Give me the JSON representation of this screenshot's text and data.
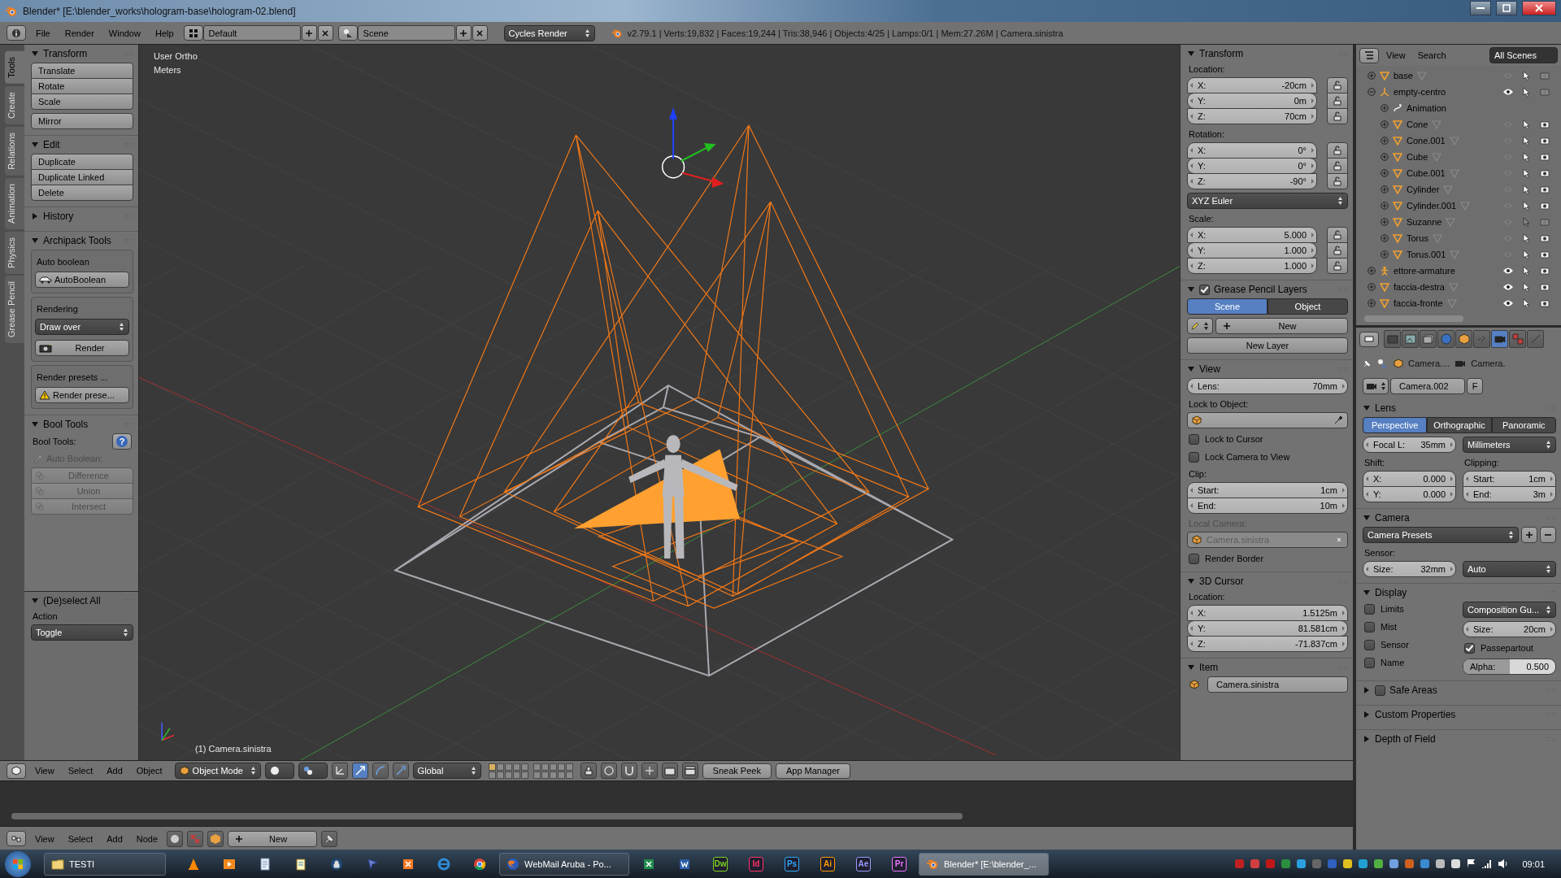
{
  "window": {
    "title": "Blender* [E:\\blender_works\\hologram-base\\hologram-02.blend]"
  },
  "info_header": {
    "menus": [
      "File",
      "Render",
      "Window",
      "Help"
    ],
    "layout": "Default",
    "scene": "Scene",
    "engine": "Cycles Render",
    "stats": "v2.79.1 | Verts:19,832 | Faces:19,244 | Tris:38,946 | Objects:4/25 | Lamps:0/1 | Mem:27.26M | Camera.sinistra"
  },
  "tool_tabs": [
    {
      "label": "Tools",
      "selected": true
    },
    {
      "label": "Create",
      "selected": false
    },
    {
      "label": "Relations",
      "selected": false
    },
    {
      "label": "Animation",
      "selected": false
    },
    {
      "label": "Physics",
      "selected": false
    },
    {
      "label": "Grease Pencil",
      "selected": false
    }
  ],
  "tool_shelf": {
    "panels": [
      {
        "title": "Transform",
        "expanded": true,
        "rows": [
          {
            "kind": "buttons",
            "labels": [
              "Translate",
              "Rotate",
              "Scale"
            ]
          },
          {
            "kind": "buttons",
            "labels": [
              "Mirror"
            ]
          }
        ]
      },
      {
        "title": "Edit",
        "expanded": true,
        "rows": [
          {
            "kind": "buttons",
            "labels": [
              "Duplicate",
              "Duplicate Linked",
              "Delete"
            ]
          }
        ]
      },
      {
        "title": "History",
        "expanded": false
      },
      {
        "title": "Archipack Tools",
        "expanded": true,
        "rows": [
          {
            "kind": "box",
            "rows": [
              {
                "kind": "label",
                "text": "Auto boolean"
              },
              {
                "kind": "car_button",
                "text": "AutoBoolean"
              }
            ]
          },
          {
            "kind": "box",
            "rows": [
              {
                "kind": "label",
                "text": "Rendering"
              },
              {
                "kind": "dropdown",
                "text": "Draw over"
              },
              {
                "kind": "render_button",
                "text": "Render"
              }
            ]
          },
          {
            "kind": "box",
            "rows": [
              {
                "kind": "label",
                "text": "Render presets ..."
              },
              {
                "kind": "warning_button",
                "text": "Render prese..."
              }
            ]
          }
        ]
      },
      {
        "title": "Bool Tools",
        "expanded": true,
        "rows": [
          {
            "kind": "help_row",
            "text": "Bool Tools:",
            "glyph": "?"
          },
          {
            "kind": "wrench_label",
            "text": "Auto Boolean:"
          },
          {
            "kind": "dim_buttons",
            "labels": [
              "Difference",
              "Union",
              "Intersect"
            ]
          }
        ]
      }
    ]
  },
  "operator_panel": {
    "panels": [
      {
        "title": "(De)select All",
        "expanded": true,
        "rows": [
          {
            "kind": "label",
            "text": "Action"
          },
          {
            "kind": "dropdown",
            "text": "Toggle"
          }
        ]
      }
    ]
  },
  "viewport": {
    "view_name": "User Ortho",
    "units": "Meters",
    "active_object": "(1) Camera.sinistra"
  },
  "n_panel": {
    "panels": [
      {
        "title": "Transform",
        "expanded": true,
        "rows": [
          {
            "kind": "label",
            "text": "Location:"
          },
          {
            "kind": "locked_numfields",
            "fields": [
              {
                "label": "X:",
                "value": "-20cm"
              },
              {
                "label": "Y:",
                "value": "0m"
              },
              {
                "label": "Z:",
                "value": "70cm"
              }
            ]
          },
          {
            "kind": "label",
            "text": "Rotation:"
          },
          {
            "kind": "locked_numfields",
            "fields": [
              {
                "label": "X:",
                "value": "0°"
              },
              {
                "label": "Y:",
                "value": "0°"
              },
              {
                "label": "Z:",
                "value": "-90°"
              }
            ]
          },
          {
            "kind": "dropdown",
            "text": "XYZ Euler"
          },
          {
            "kind": "label",
            "text": "Scale:"
          },
          {
            "kind": "locked_numfields",
            "fields": [
              {
                "label": "X:",
                "value": "5.000"
              },
              {
                "label": "Y:",
                "value": "1.000"
              },
              {
                "label": "Z:",
                "value": "1.000"
              }
            ]
          }
        ]
      },
      {
        "title": "Grease Pencil Layers",
        "checked": true,
        "expanded": true,
        "rows": [
          {
            "kind": "segmented",
            "options": [
              {
                "label": "Scene",
                "selected": true
              },
              {
                "label": "Object",
                "selected": false
              }
            ]
          },
          {
            "kind": "pencil_new",
            "text": "New"
          },
          {
            "kind": "button",
            "text": "New Layer"
          }
        ]
      },
      {
        "title": "View",
        "expanded": true,
        "rows": [
          {
            "kind": "numfields",
            "fields": [
              {
                "label": "Lens:",
                "value": "70mm"
              }
            ]
          },
          {
            "kind": "label",
            "text": "Lock to Object:"
          },
          {
            "kind": "picker_field"
          },
          {
            "kind": "checkbox",
            "text": "Lock to Cursor",
            "checked": false
          },
          {
            "kind": "checkbox",
            "text": "Lock Camera to View",
            "checked": false
          },
          {
            "kind": "label",
            "text": "Clip:"
          },
          {
            "kind": "numfields",
            "fields": [
              {
                "label": "Start:",
                "value": "1cm"
              },
              {
                "label": "End:",
                "value": "10m"
              }
            ]
          },
          {
            "kind": "dim_label",
            "text": "Local Camera:"
          },
          {
            "kind": "dim_object_field",
            "text": "Camera.sinistra"
          },
          {
            "kind": "checkbox",
            "text": "Render Border",
            "checked": false
          }
        ]
      },
      {
        "title": "3D Cursor",
        "expanded": true,
        "rows": [
          {
            "kind": "label",
            "text": "Location:"
          },
          {
            "kind": "numfields",
            "fields": [
              {
                "label": "X:",
                "value": "1.5125m"
              },
              {
                "label": "Y:",
                "value": "81.581cm"
              },
              {
                "label": "Z:",
                "value": "-71.837cm"
              }
            ]
          }
        ]
      },
      {
        "title": "Item",
        "expanded": true,
        "rows": [
          {
            "kind": "item_field",
            "text": "Camera.sinistra"
          }
        ]
      }
    ]
  },
  "outliner": {
    "menus": [
      "View",
      "Search"
    ],
    "filter": "All Scenes",
    "items": [
      {
        "name": "base",
        "kind": "mesh",
        "expanded": false,
        "visible": false,
        "selectable": true,
        "renderable": false
      },
      {
        "name": "empty-centro",
        "kind": "empty",
        "expanded": true,
        "visible": true,
        "selectable": true,
        "renderable": false,
        "children": [
          {
            "name": "Animation",
            "kind": "action",
            "expanded": false
          },
          {
            "name": "Cone",
            "kind": "mesh",
            "expanded": false,
            "visible": false,
            "selectable": true,
            "renderable": true
          },
          {
            "name": "Cone.001",
            "kind": "mesh",
            "expanded": false,
            "visible": false,
            "selectable": true,
            "renderable": true
          },
          {
            "name": "Cube",
            "kind": "mesh",
            "expanded": false,
            "visible": false,
            "selectable": true,
            "renderable": true
          },
          {
            "name": "Cube.001",
            "kind": "mesh",
            "expanded": false,
            "visible": false,
            "selectable": true,
            "renderable": true
          },
          {
            "name": "Cylinder",
            "kind": "mesh",
            "expanded": false,
            "visible": false,
            "selectable": true,
            "renderable": true
          },
          {
            "name": "Cylinder.001",
            "kind": "mesh",
            "expanded": false,
            "visible": false,
            "selectable": true,
            "renderable": true
          },
          {
            "name": "Suzanne",
            "kind": "mesh",
            "expanded": false,
            "visible": false,
            "selectable": false,
            "renderable": false
          },
          {
            "name": "Torus",
            "kind": "mesh",
            "expanded": false,
            "visible": false,
            "selectable": true,
            "renderable": true
          },
          {
            "name": "Torus.001",
            "kind": "mesh",
            "expanded": false,
            "visible": false,
            "selectable": true,
            "renderable": true
          }
        ]
      },
      {
        "name": "ettore-armature",
        "kind": "armature",
        "expanded": false,
        "visible": true,
        "selectable": true,
        "renderable": true
      },
      {
        "name": "faccia-destra",
        "kind": "mesh",
        "expanded": false,
        "visible": true,
        "selectable": true,
        "renderable": true
      },
      {
        "name": "faccia-fronte",
        "kind": "mesh",
        "expanded": false,
        "visible": true,
        "selectable": true,
        "renderable": true
      }
    ]
  },
  "properties": {
    "tabs": [
      {
        "kind": "camera",
        "selected": false
      },
      {
        "kind": "image",
        "selected": false
      },
      {
        "kind": "layers",
        "selected": false
      },
      {
        "kind": "globe",
        "selected": false
      },
      {
        "kind": "cube",
        "selected": false
      },
      {
        "kind": "chain",
        "selected": false
      },
      {
        "kind": "data",
        "selected": true
      },
      {
        "kind": "checker",
        "selected": false
      },
      {
        "kind": "brush",
        "selected": false
      }
    ],
    "breadcrumb": [
      "Camera....",
      "Camera."
    ],
    "datablock": {
      "name": "Camera.002",
      "fake_user": "F"
    },
    "panels": [
      {
        "title": "Lens",
        "expanded": true,
        "rows": [
          {
            "kind": "segmented",
            "options": [
              {
                "label": "Perspective",
                "selected": true
              },
              {
                "label": "Orthographic",
                "selected": false
              },
              {
                "label": "Panoramic",
                "selected": false
              }
            ]
          },
          {
            "kind": "two_col",
            "cols": [
              [
                {
                  "kind": "numfields",
                  "fields": [
                    {
                      "label": "Focal L:",
                      "value": "35mm"
                    }
                  ]
                }
              ],
              [
                {
                  "kind": "dropdown",
                  "text": "Millimeters"
                }
              ]
            ]
          },
          {
            "kind": "two_col",
            "cols": [
              [
                {
                  "kind": "label",
                  "text": "Shift:"
                },
                {
                  "kind": "numfields",
                  "fields": [
                    {
                      "label": "X:",
                      "value": "0.000"
                    },
                    {
                      "label": "Y:",
                      "value": "0.000"
                    }
                  ]
                }
              ],
              [
                {
                  "kind": "label",
                  "text": "Clipping:"
                },
                {
                  "kind": "numfields",
                  "fields": [
                    {
                      "label": "Start:",
                      "value": "1cm"
                    },
                    {
                      "label": "End:",
                      "value": "3m"
                    }
                  ]
                }
              ]
            ]
          }
        ]
      },
      {
        "title": "Camera",
        "expanded": true,
        "rows": [
          {
            "kind": "presets_row",
            "text": "Camera Presets"
          },
          {
            "kind": "label",
            "text": "Sensor:"
          },
          {
            "kind": "two_col",
            "cols": [
              [
                {
                  "kind": "numfields",
                  "fields": [
                    {
                      "label": "Size:",
                      "value": "32mm"
                    }
                  ]
                }
              ],
              [
                {
                  "kind": "dropdown",
                  "text": "Auto"
                }
              ]
            ]
          }
        ]
      },
      {
        "title": "Display",
        "expanded": true,
        "rows": [
          {
            "kind": "two_col",
            "cols": [
              [
                {
                  "kind": "checkbox",
                  "text": "Limits",
                  "checked": false
                },
                {
                  "kind": "checkbox",
                  "text": "Mist",
                  "checked": false
                },
                {
                  "kind": "checkbox",
                  "text": "Sensor",
                  "checked": false
                },
                {
                  "kind": "checkbox",
                  "text": "Name",
                  "checked": false
                }
              ],
              [
                {
                  "kind": "dropdown",
                  "text": "Composition Gu..."
                },
                {
                  "kind": "numfields",
                  "fields": [
                    {
                      "label": "Size:",
                      "value": "20cm"
                    }
                  ]
                },
                {
                  "kind": "checkbox",
                  "text": "Passepartout",
                  "checked": true
                },
                {
                  "kind": "slider",
                  "label": "Alpha:",
                  "value": "0.500",
                  "level": 0.5
                }
              ]
            ]
          }
        ]
      },
      {
        "title": "Safe Areas",
        "checked": false,
        "expanded": false
      },
      {
        "title": "Custom Properties",
        "expanded": false
      },
      {
        "title": "Depth of Field",
        "expanded": false
      }
    ]
  },
  "view3d_header": {
    "menus": [
      "View",
      "Select",
      "Add",
      "Object"
    ],
    "mode": "Object Mode",
    "orientation": "Global",
    "layers": [
      {
        "selected": true
      },
      {
        "selected": false
      },
      {
        "selected": false
      },
      {
        "selected": false
      },
      {
        "selected": false
      },
      {
        "selected": false
      },
      {
        "selected": false
      },
      {
        "selected": false
      },
      {
        "selected": false
      },
      {
        "selected": false
      },
      {
        "selected": false
      },
      {
        "selected": false
      },
      {
        "selected": false
      },
      {
        "selected": false
      },
      {
        "selected": false
      },
      {
        "selected": false
      },
      {
        "selected": false
      },
      {
        "selected": false
      },
      {
        "selected": false
      },
      {
        "selected": false
      }
    ],
    "buttons": [
      "Sneak Peek",
      "App Manager"
    ]
  },
  "node_header": {
    "menus": [
      "View",
      "Select",
      "Add",
      "Node"
    ],
    "new_button": "New"
  },
  "taskbar": {
    "items": [
      {
        "kind": "folder",
        "label": "TESTI",
        "selected": false
      },
      {
        "kind": "vlc",
        "selected": false
      },
      {
        "kind": "media",
        "selected": false
      },
      {
        "kind": "notes",
        "selected": false
      },
      {
        "kind": "notepad",
        "selected": false
      },
      {
        "kind": "keepass",
        "selected": false
      },
      {
        "kind": "inkscape",
        "selected": false
      },
      {
        "kind": "xampp",
        "selected": false
      },
      {
        "kind": "ie",
        "selected": false
      },
      {
        "kind": "chrome",
        "selected": false
      },
      {
        "kind": "firefox",
        "label": "WebMail Aruba - Po...",
        "selected": false
      },
      {
        "kind": "excel",
        "selected": false
      },
      {
        "kind": "word",
        "selected": false
      },
      {
        "kind": "adobe",
        "label": "Dw",
        "color": "#7ed321",
        "selected": false
      },
      {
        "kind": "adobe",
        "label": "Id",
        "color": "#ff3366",
        "selected": false
      },
      {
        "kind": "adobe",
        "label": "Ps",
        "color": "#31a8ff",
        "selected": false
      },
      {
        "kind": "adobe",
        "label": "Ai",
        "color": "#ff9a00",
        "selected": false
      },
      {
        "kind": "adobe",
        "label": "Ae",
        "color": "#9999ff",
        "selected": false
      },
      {
        "kind": "adobe",
        "label": "Pr",
        "color": "#ea77ff",
        "selected": false
      },
      {
        "kind": "blender",
        "label": "Blender* [E:\\blender_...",
        "selected": true
      }
    ],
    "time": "09:01"
  }
}
